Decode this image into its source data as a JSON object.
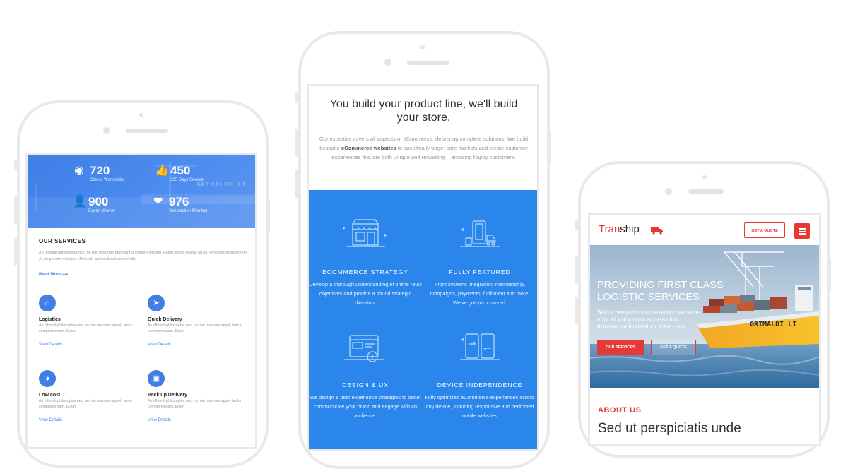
{
  "phone_left": {
    "stats": [
      {
        "icon": "globe-icon",
        "value": "720",
        "label": "Clients Worldwide"
      },
      {
        "icon": "thumbs-up-icon",
        "value": "450",
        "label": "365 Days Service"
      },
      {
        "icon": "person-icon",
        "value": "900",
        "label": "Expert Worker"
      },
      {
        "icon": "heart-icon",
        "value": "976",
        "label": "Satisfaction Member"
      }
    ],
    "ship_text": "GRIMALDI LI",
    "services_title": "OUR SERVICES",
    "services_intro": "An offendit philosophia nec, no mei maiorum appellantur comprehensam. Etiam primis detenit ad pri, ei fuisset detracto mel. At vis possim noluisse efficiendi, qui eu dicant expetendis.",
    "read_more": "Read More",
    "services": [
      {
        "icon": "magnet-icon",
        "name": "Logistics",
        "desc": "An offendit philosophia nec, no mei maiorum appel- lantur comprehensam. Etiam",
        "link": "View Details"
      },
      {
        "icon": "paper-plane-icon",
        "name": "Quick Delivery",
        "desc": "An offendit philosophia nec, no mei maiorum appel- lantur comprehensam. Etiam",
        "link": "View Details"
      },
      {
        "icon": "pie-chart-icon",
        "name": "Low cost",
        "desc": "An offendit philosophia nec, no mei maiorum appel- lantur comprehensam. Etiam",
        "link": "View Details"
      },
      {
        "icon": "briefcase-icon",
        "name": "Pack up Delivery",
        "desc": "An offendit philosophia nec, no mei maiorum appel- lantur comprehensam. Etiam",
        "link": "View Details"
      }
    ]
  },
  "phone_center": {
    "title": "You build your product line, we'll build your store.",
    "intro_before": "Our expertise covers all aspects of eCommerce, delivering complete solutions. We build bespoke ",
    "intro_bold": "eCommerce websites",
    "intro_after": " to specifically target core markets and create customer experiences that are both unique and rewarding – ensuring happy customers.",
    "features": [
      {
        "icon": "storefront-icon",
        "name": "ECOMMERCE STRATEGY",
        "desc": "Develop a thorough understanding of online retail objectives and provide a sound strategic direction."
      },
      {
        "icon": "shopping-devices-icon",
        "name": "FULLY FEATURED",
        "desc": "From systems integration, membership, campaigns, payments, fulfillment and more. We've got you covered."
      },
      {
        "icon": "design-screen-icon",
        "name": "DESIGN & UX",
        "desc": "We design & user experience strategies to better communicate your brand and engage with an audience."
      },
      {
        "icon": "device-sync-icon",
        "name": "DEVICE INDEPENDENCE",
        "desc": "Fully optimized eCommerce experiences across any device, including responsive and dedicated mobile websites."
      }
    ],
    "accent_color": "#2a86ea"
  },
  "phone_right": {
    "logo_red": "Tran",
    "logo_dark": "ship",
    "quote_button": "GET A QUOTE",
    "hero_title_line1": "PROVIDING FIRST CLASS",
    "hero_title_line2": "LOGISTIC SERVICES",
    "hero_text": "Sed ut perspiciatis unde omnis iste natus error sit voluptatem accusantium doloremque laudantium, totam rem",
    "ship_text": "GRIMALDI LI",
    "btn_services": "OUR SERVICES",
    "btn_quote": "GET A QUOTE",
    "about_title": "ABOUT US",
    "about_heading": "Sed ut perspiciatis unde",
    "accent_color": "#e53935"
  }
}
